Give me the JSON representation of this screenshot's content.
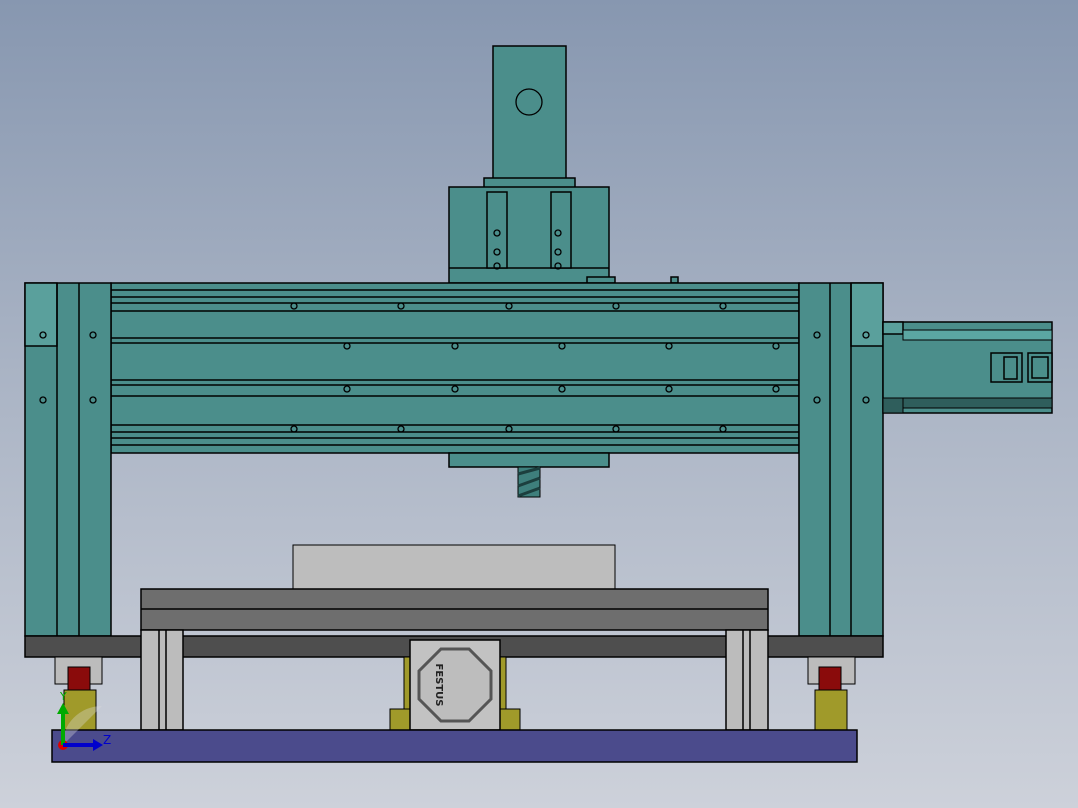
{
  "model": {
    "logo_text": "FESTUS",
    "colors": {
      "frame": "#4b8e8b",
      "base_plate": "#4b4b8c",
      "feet": "#a09a2a",
      "stops": "#8a0b0b",
      "table": "#6e6e6e",
      "workpiece": "#bdbdbd"
    }
  },
  "triad": {
    "y_label": "Y",
    "z_label": "Z"
  }
}
